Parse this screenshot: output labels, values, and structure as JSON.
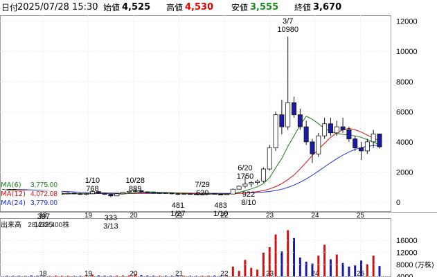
{
  "header": {
    "label": "日付",
    "datetime": "2025/07/28 15:30",
    "open_label": "始値",
    "open_value": "4,525",
    "high_label": "高値",
    "high_value": "4,530",
    "low_label": "安値",
    "low_value": "3,555",
    "close_label": "終値",
    "close_value": "3,670"
  },
  "colors": {
    "up": "#ffffff",
    "down": "#1a1aa6",
    "ma6": "#1a7a1a",
    "ma12": "#d01010",
    "ma24": "#2030d0",
    "high_value_color": "#e00000",
    "low_value_color": "#1a8a1a",
    "vol_up": "#d01010",
    "vol_down": "#1a1aa6"
  },
  "ma_legend": [
    {
      "label": "MA(6)",
      "value": "3,775.00"
    },
    {
      "label": "MA(12)",
      "value": "4,072.08"
    },
    {
      "label": "MA(24)",
      "value": "3,779.00"
    }
  ],
  "volume": {
    "label": "出来高",
    "value": "28,439,400株",
    "unit": "(万株)",
    "ticks": [
      "16000",
      "12000",
      "8000",
      "4000"
    ]
  },
  "chart_data": {
    "type": "candlestick",
    "price_ticks": [
      12000,
      10000,
      8000,
      6000,
      4000,
      2000,
      0
    ],
    "ylim": [
      -600,
      12400
    ],
    "x_ticks": [
      "18",
      "19",
      "20",
      "21",
      "22",
      "23",
      "24",
      "25"
    ],
    "annotations": [
      {
        "label": "5/31",
        "value": "999"
      },
      {
        "label": "12/25",
        "value": "397"
      },
      {
        "label": "1/10",
        "value": "768"
      },
      {
        "label": "3/13",
        "value": "333"
      },
      {
        "label": "10/28",
        "value": "889"
      },
      {
        "label": "1/27",
        "value": "481"
      },
      {
        "label": "7/29",
        "value": "620"
      },
      {
        "label": "1/10",
        "value": "483"
      },
      {
        "label": "6/20",
        "value": "1750"
      },
      {
        "label": "8/10",
        "value": "922"
      },
      {
        "label": "3/7",
        "value": "10980"
      }
    ],
    "candles": [
      [
        780,
        820,
        640,
        700
      ],
      [
        700,
        760,
        600,
        640
      ],
      [
        640,
        700,
        560,
        610
      ],
      [
        610,
        660,
        520,
        560
      ],
      [
        560,
        620,
        480,
        540
      ],
      [
        540,
        600,
        430,
        470
      ],
      [
        470,
        520,
        397,
        440
      ],
      [
        440,
        560,
        420,
        520
      ],
      [
        520,
        600,
        470,
        560
      ],
      [
        560,
        640,
        500,
        590
      ],
      [
        590,
        660,
        520,
        600
      ],
      [
        600,
        640,
        520,
        560
      ],
      [
        560,
        620,
        480,
        520
      ],
      [
        520,
        600,
        460,
        560
      ],
      [
        560,
        768,
        540,
        700
      ],
      [
        700,
        740,
        560,
        600
      ],
      [
        600,
        640,
        480,
        520
      ],
      [
        520,
        560,
        333,
        420
      ],
      [
        420,
        600,
        400,
        560
      ],
      [
        560,
        700,
        520,
        660
      ],
      [
        660,
        760,
        600,
        720
      ],
      [
        720,
        889,
        660,
        760
      ],
      [
        760,
        800,
        640,
        680
      ],
      [
        680,
        720,
        600,
        640
      ],
      [
        640,
        680,
        560,
        600
      ],
      [
        600,
        660,
        540,
        620
      ],
      [
        620,
        660,
        560,
        600
      ],
      [
        600,
        640,
        520,
        560
      ],
      [
        560,
        600,
        481,
        520
      ],
      [
        520,
        580,
        500,
        560
      ],
      [
        560,
        600,
        500,
        540
      ],
      [
        540,
        580,
        480,
        520
      ],
      [
        520,
        560,
        480,
        540
      ],
      [
        540,
        620,
        500,
        580
      ],
      [
        580,
        600,
        500,
        520
      ],
      [
        520,
        560,
        483,
        500
      ],
      [
        500,
        560,
        480,
        540
      ],
      [
        540,
        900,
        520,
        860
      ],
      [
        860,
        1100,
        840,
        1060
      ],
      [
        1060,
        1750,
        922,
        1200
      ],
      [
        1200,
        1400,
        1000,
        1300
      ],
      [
        1300,
        1500,
        1150,
        1400
      ],
      [
        1400,
        2300,
        1300,
        2200
      ],
      [
        2200,
        3800,
        2100,
        3600
      ],
      [
        3600,
        6000,
        3400,
        5800
      ],
      [
        5800,
        6800,
        4500,
        5000
      ],
      [
        5000,
        10980,
        4800,
        6600
      ],
      [
        6600,
        7000,
        5600,
        5800
      ],
      [
        5800,
        6200,
        4800,
        5000
      ],
      [
        5000,
        5400,
        3800,
        4000
      ],
      [
        4000,
        4200,
        2600,
        3200
      ],
      [
        3200,
        4600,
        3000,
        4400
      ],
      [
        4400,
        5600,
        4200,
        5200
      ],
      [
        5200,
        5600,
        4400,
        4600
      ],
      [
        4600,
        5400,
        4400,
        5000
      ],
      [
        5000,
        5600,
        4600,
        4800
      ],
      [
        4800,
        5000,
        4000,
        4200
      ],
      [
        4200,
        4400,
        3400,
        3600
      ],
      [
        3600,
        4000,
        2800,
        3400
      ],
      [
        3400,
        4200,
        3200,
        4000
      ],
      [
        4000,
        4800,
        3600,
        4525
      ],
      [
        4525,
        4530,
        3555,
        3670
      ]
    ],
    "ma6": [
      820,
      780,
      740,
      700,
      660,
      620,
      560,
      530,
      520,
      530,
      550,
      560,
      560,
      555,
      590,
      600,
      590,
      560,
      540,
      540,
      580,
      620,
      660,
      680,
      680,
      660,
      640,
      620,
      595,
      575,
      560,
      545,
      535,
      535,
      540,
      535,
      525,
      575,
      655,
      760,
      880,
      1020,
      1230,
      1620,
      2280,
      2900,
      3700,
      4400,
      5100,
      5700,
      5500,
      5200,
      4900,
      4700,
      4550,
      4500,
      4450,
      4400,
      4300,
      4150,
      4000,
      3775
    ],
    "ma12": [
      840,
      820,
      800,
      780,
      750,
      710,
      670,
      640,
      610,
      590,
      575,
      565,
      560,
      555,
      560,
      570,
      575,
      570,
      565,
      560,
      570,
      585,
      600,
      615,
      625,
      630,
      630,
      625,
      615,
      605,
      595,
      585,
      575,
      565,
      560,
      555,
      550,
      560,
      580,
      610,
      650,
      700,
      770,
      880,
      1030,
      1230,
      1500,
      1800,
      2200,
      2650,
      3100,
      3500,
      3900,
      4300,
      4600,
      4800,
      4900,
      4800,
      4650,
      4450,
      4250,
      4072
    ],
    "ma24": [
      860,
      850,
      840,
      830,
      815,
      800,
      780,
      760,
      740,
      720,
      700,
      680,
      660,
      645,
      635,
      625,
      615,
      605,
      595,
      590,
      585,
      580,
      580,
      580,
      585,
      590,
      595,
      598,
      600,
      600,
      598,
      596,
      594,
      592,
      590,
      588,
      586,
      588,
      594,
      604,
      620,
      640,
      670,
      710,
      770,
      860,
      980,
      1130,
      1320,
      1540,
      1790,
      2060,
      2340,
      2620,
      2880,
      3120,
      3330,
      3500,
      3620,
      3700,
      3760,
      3779
    ],
    "volumes": [
      200,
      150,
      180,
      120,
      300,
      220,
      160,
      140,
      250,
      180,
      170,
      130,
      190,
      160,
      600,
      320,
      260,
      200,
      240,
      280,
      300,
      700,
      420,
      260,
      220,
      180,
      200,
      230,
      180,
      160,
      170,
      150,
      190,
      220,
      260,
      200,
      180,
      3200,
      1800,
      5400,
      2800,
      2200,
      7800,
      9600,
      13800,
      8200,
      15200,
      12600,
      6200,
      4800,
      4200,
      6800,
      10400,
      5600,
      7200,
      4400,
      3200,
      3600,
      5200,
      4000,
      6800,
      3400
    ],
    "volume_ylim": [
      0,
      18500
    ]
  }
}
